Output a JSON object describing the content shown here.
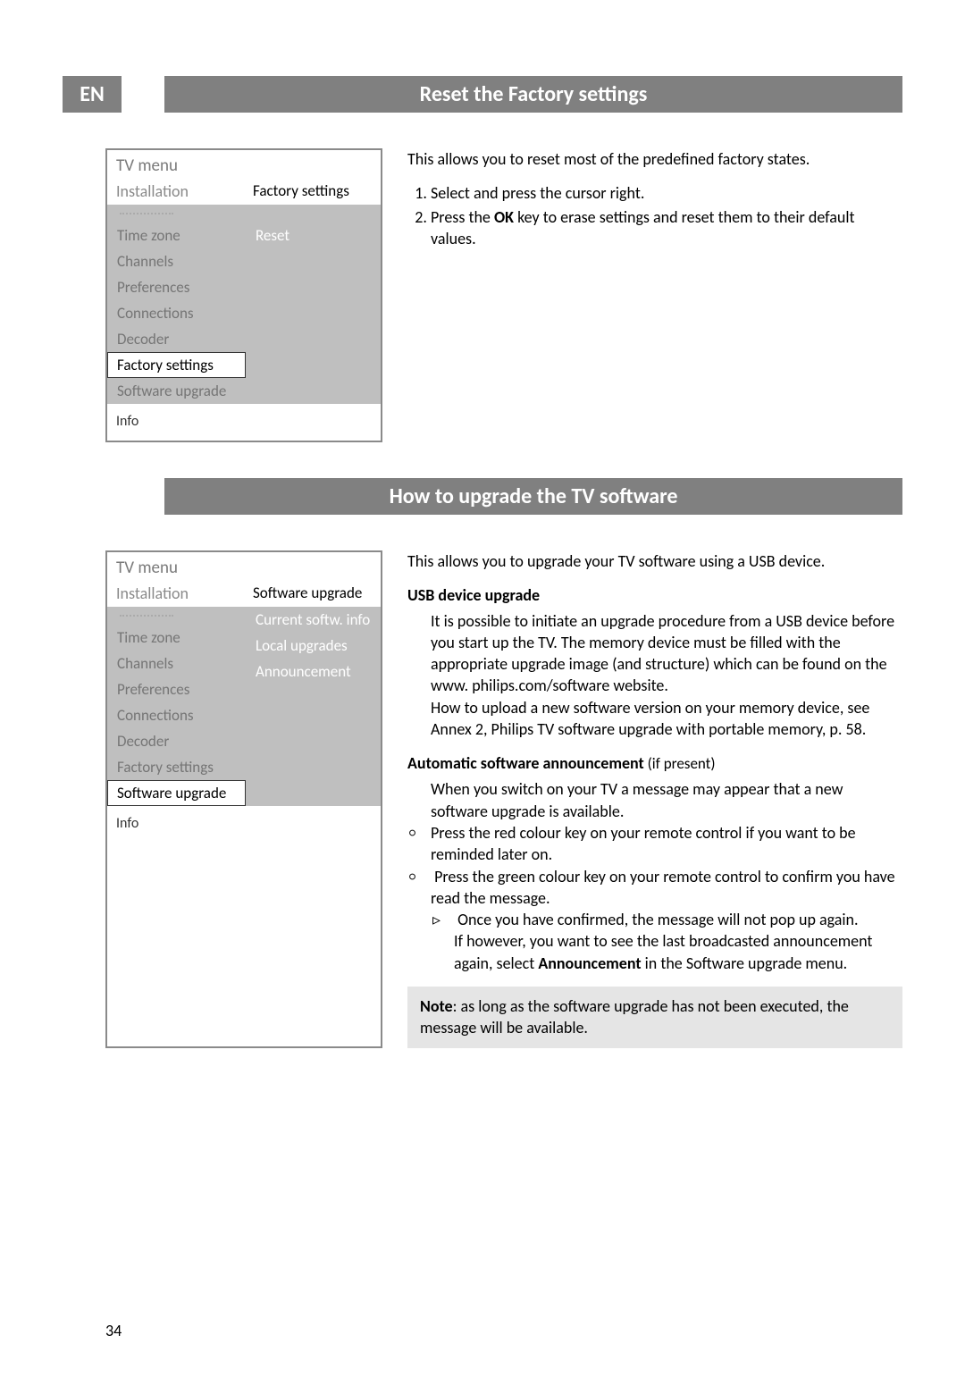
{
  "lang": "EN",
  "page_number": "34",
  "section1": {
    "title": "Reset the Factory settings",
    "menu": {
      "title": "TV menu",
      "sub_left": "Installation",
      "sub_right": "Factory settings",
      "left_items": [
        "Time zone",
        "Channels",
        "Preferences",
        "Connections",
        "Decoder",
        "Factory settings",
        "Software upgrade"
      ],
      "left_selected_index": 5,
      "right_items": [
        "Reset"
      ],
      "info": "Info"
    },
    "intro": "This allows you to reset most of the predefined factory states.",
    "steps": {
      "s1": "Select and press the cursor right.",
      "s2_a": "Press the ",
      "s2_b": "OK",
      "s2_c": " key to erase settings and reset them to their default values."
    }
  },
  "section2": {
    "title": "How to upgrade the TV software",
    "menu": {
      "title": "TV menu",
      "sub_left": "Installation",
      "sub_right": "Software upgrade",
      "left_items": [
        "Time zone",
        "Channels",
        "Preferences",
        "Connections",
        "Decoder",
        "Factory settings",
        "Software upgrade"
      ],
      "left_selected_index": 6,
      "right_items": [
        "Current softw. info",
        "Local upgrades",
        "Announcement"
      ],
      "info": "Info"
    },
    "intro": "This allows you to upgrade your TV software using a USB device.",
    "usb_head": "USB device upgrade",
    "usb_p1": "It is possible to initiate an upgrade procedure from a USB device before you start up the TV. The memory device must be filled with the appropriate upgrade image (and structure) which can be found on the www. philips.com/software website.",
    "usb_p2": "How to upload a new software version on your memory device, see Annex 2, Philips TV software upgrade with portable memory, p. 58.",
    "auto_head": "Automatic software announcement",
    "auto_suffix": " (if present)",
    "auto_p1": "When you switch on your TV a message may appear that a new software upgrade is available.",
    "auto_b1": "Press the red colour key on your remote control if you want to be reminded later on.",
    "auto_b2": "Press the green colour key on your remote control to confirm you have read the message.",
    "auto_sub1": "Once you have confirmed, the message will not pop up again.",
    "auto_sub2_a": "If however, you want to see the last broadcasted announcement again, select ",
    "auto_sub2_b": "Announcement",
    "auto_sub2_c": " in the Software upgrade menu.",
    "note_label": "Note",
    "note_text": ": as long as the software upgrade has not been executed, the message will be available."
  }
}
